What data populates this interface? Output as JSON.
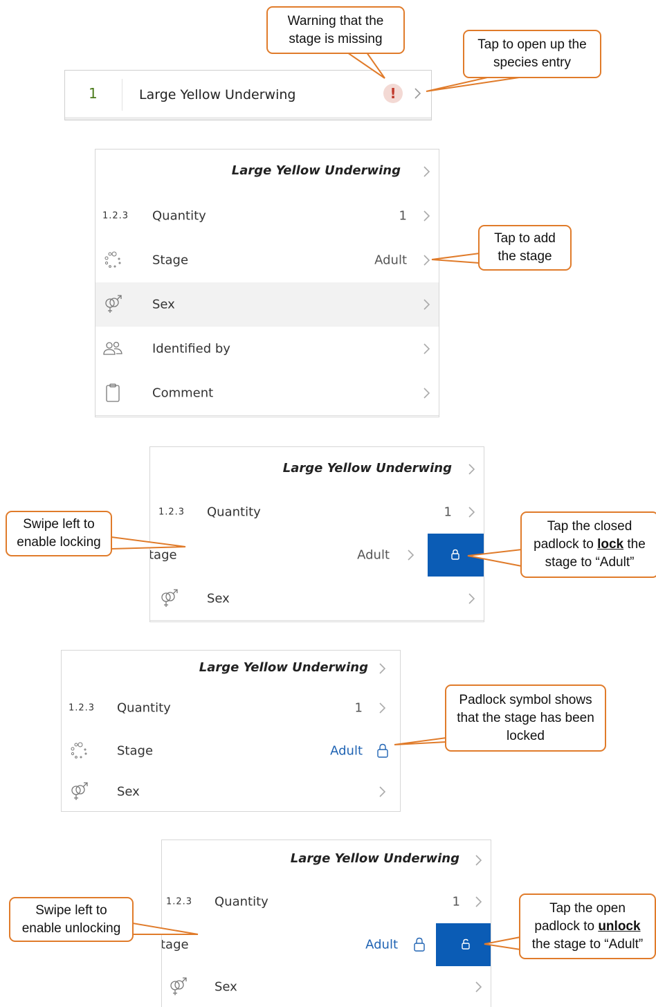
{
  "species_name": "Large Yellow Underwing",
  "row1": {
    "count": "1"
  },
  "labels": {
    "quantity": "Quantity",
    "quantity_prefix": "1.2.3",
    "stage": "Stage",
    "stage_cut": "tage",
    "sex": "Sex",
    "identified_by": "Identified by",
    "comment": "Comment"
  },
  "values": {
    "quantity": "1",
    "stage": "Adult"
  },
  "callouts": {
    "warning": "Warning that the stage is missing",
    "open_entry": "Tap to open up the species entry",
    "add_stage": "Tap to add the stage",
    "swipe_lock": "Swipe left to enable locking",
    "lock_pre": "Tap the closed padlock to ",
    "lock_word": "lock",
    "lock_post": " the stage to “Adult”",
    "locked": "Padlock symbol shows that the stage has been locked",
    "swipe_unlock": "Swipe left to enable unlocking",
    "unlock_pre": "Tap the open padlock to ",
    "unlock_word": "unlock",
    "unlock_post": " the stage to “Adult”"
  },
  "icons": [
    "warning-icon",
    "chevron-right-icon",
    "quantity-icon",
    "stage-dots-icon",
    "sex-symbol-icon",
    "people-icon",
    "clipboard-icon",
    "padlock-closed-icon",
    "padlock-open-icon"
  ],
  "colors": {
    "accent": "#0b5cb5",
    "callout_border": "#e07b2a",
    "count_green": "#4a7a1a",
    "warning_fill": "#f3d9d4",
    "warning_mark": "#c0392b"
  }
}
